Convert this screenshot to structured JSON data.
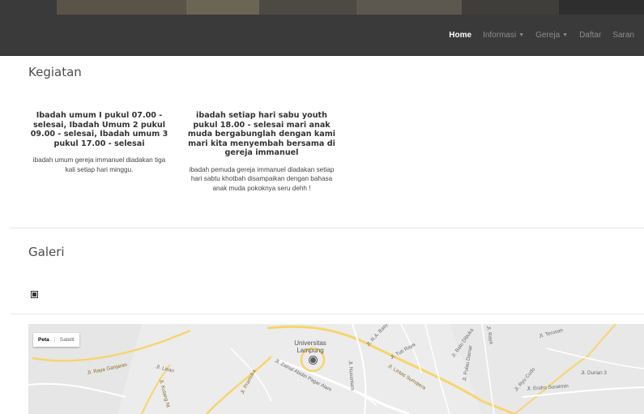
{
  "nav": {
    "items": [
      {
        "label": "Home",
        "active": true,
        "dropdown": false
      },
      {
        "label": "Informasi",
        "active": false,
        "dropdown": true
      },
      {
        "label": "Gereja",
        "active": false,
        "dropdown": true
      },
      {
        "label": "Daftar",
        "active": false,
        "dropdown": false
      },
      {
        "label": "Saran",
        "active": false,
        "dropdown": false
      }
    ]
  },
  "kegiatan": {
    "heading": "Kegiatan",
    "cards": [
      {
        "title": "Ibadah umum I pukul 07.00 - selesai, Ibadah Umum 2 pukul 09.00 - selesai, Ibadah umum 3 pukul 17.00 - selesai",
        "desc": "ibadah umum gereja immanuel diadakan tiga kali setiap hari minggu."
      },
      {
        "title": "ibadah setiap hari sabu youth pukul 18.00 - selesai mari anak muda bergabunglah dengan kami mari kita menyembah bersama di gereja immanuel",
        "desc": "ibadah pemuda gereja immanuel diadakan setiap hari sabtu khotbah disampaikan dengan bahasa anak muda pokoknya seru dehh !"
      }
    ]
  },
  "galeri": {
    "heading": "Galeri",
    "image_icon": "broken-image-icon"
  },
  "map": {
    "type_options": [
      "Peta",
      "Satelit"
    ],
    "selected_type": "Peta",
    "poi": "Universitas Lampung",
    "labels": [
      "Jl. Raya Ganjaran",
      "Jl. Lisan",
      "Jl. Kutang Ni",
      "Jl. Pramuka",
      "Jl. Zainal Abidin Pagar Alam",
      "Jl. Lintas Sumatera",
      "Jl. Tuti Raya",
      "Jl. Batu Dibuka",
      "Jl. Pulau Damar",
      "Jl. Ryu Cudo",
      "Jl. Terusan",
      "Jl. Durian 3",
      "Jl. Endro Suratmin",
      "Jl. Nusantara",
      "Jl. R.A. Basyid",
      "Jl. Raya"
    ]
  }
}
